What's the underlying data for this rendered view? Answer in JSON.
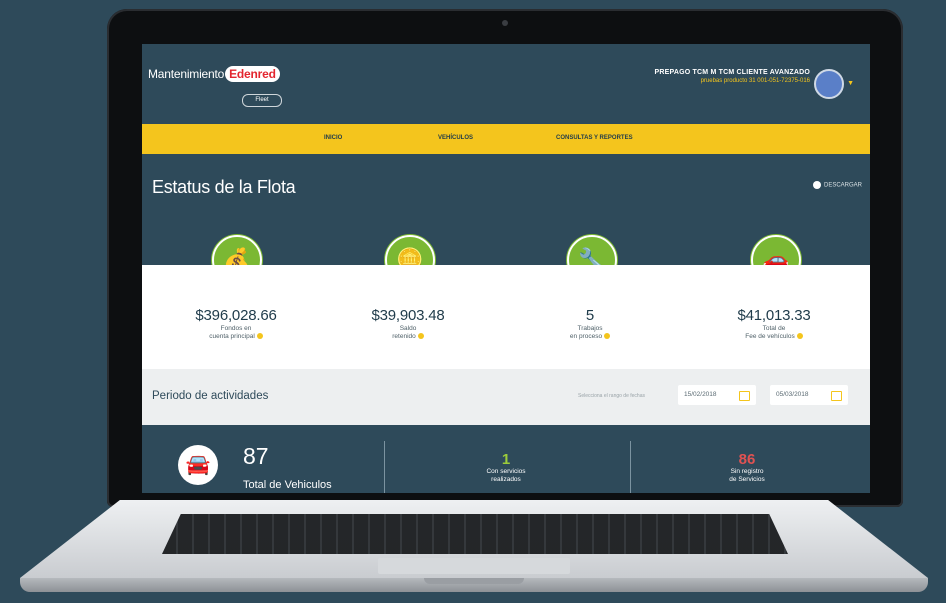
{
  "colors": {
    "background": "#2e4a5a",
    "nav": "#f4c51d",
    "accent_green": "#7bb833",
    "accent_red": "#e05252",
    "badge_red": "#e3262f"
  },
  "header": {
    "brand_text": "Mantenimiento",
    "brand_badge": "Edenred",
    "fleet_label": "Fleet",
    "user_name": "PREPAGO TCM M TCM CLIENTE AVANZADO",
    "user_account": "pruebas producto 31 001-051-72375-016"
  },
  "nav": {
    "items": [
      "INICIO",
      "VEHÍCULOS",
      "CONSULTAS Y REPORTES"
    ]
  },
  "page": {
    "title": "Estatus de la Flota",
    "download_label": "DESCARGAR"
  },
  "stats": [
    {
      "icon": "money-bag-icon",
      "value": "$396,028.66",
      "label1": "Fondos en",
      "label2": "cuenta principal"
    },
    {
      "icon": "hand-coin-icon",
      "value": "$39,903.48",
      "label1": "Saldo",
      "label2": "retenido"
    },
    {
      "icon": "car-wrench-icon",
      "value": "5",
      "label1": "Trabajos",
      "label2": "en proceso"
    },
    {
      "icon": "cars-coin-icon",
      "value": "$41,013.33",
      "label1": "Total de",
      "label2": "Fee de vehículos"
    }
  ],
  "period": {
    "title": "Periodo de actividades",
    "hint": "Selecciona el rango de fechas",
    "date_from": "15/02/2018",
    "date_to": "05/03/2018"
  },
  "summary": {
    "total_vehicles": "87",
    "total_label": "Total de Vehiculos",
    "with_service_count": "1",
    "with_service_label1": "Con servicios",
    "with_service_label2": "realizados",
    "without_record_count": "86",
    "without_record_label1": "Sin registro",
    "without_record_label2": "de Servicios"
  }
}
